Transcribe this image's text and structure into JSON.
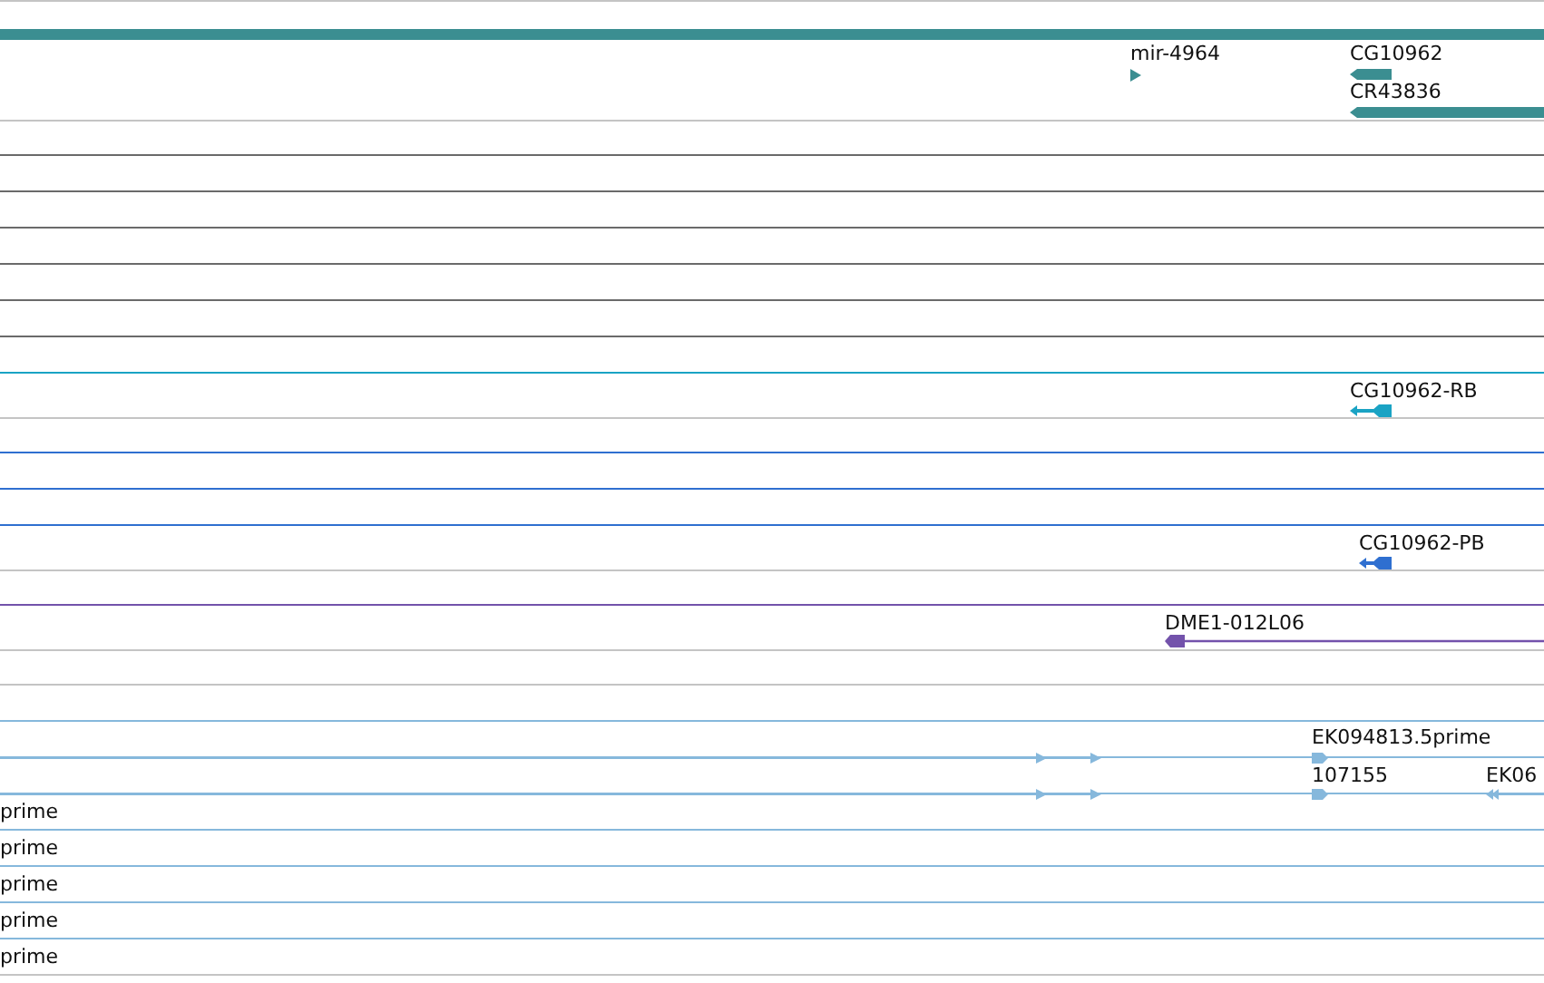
{
  "tracks": [
    {
      "color": "#3b8e91",
      "features": [
        {
          "kind": "band"
        },
        {
          "kind": "marker",
          "label": "mir-4964"
        },
        {
          "kind": "gene",
          "label": "CG10962"
        },
        {
          "kind": "gene",
          "label": "CR43836"
        }
      ]
    },
    {
      "color": "#1aa3c4",
      "features": [
        {
          "kind": "transcript",
          "label": "CG10962-RB"
        }
      ]
    },
    {
      "color": "#2f6fd0",
      "features": [
        {
          "kind": "transcript",
          "label": "CG10962-PB"
        }
      ]
    },
    {
      "color": "#7352ab",
      "features": [
        {
          "kind": "clone",
          "label": "DME1-012L06"
        }
      ]
    },
    {
      "color": "#86b8dc",
      "features": [
        {
          "kind": "pair"
        },
        {
          "kind": "read",
          "label": "EK094813.5prime"
        }
      ]
    },
    {
      "color": "#86b8dc",
      "features": [
        {
          "kind": "pair"
        },
        {
          "kind": "read",
          "label": "107155"
        },
        {
          "kind": "readleft",
          "label": "EK06"
        }
      ]
    },
    {
      "features": [
        {
          "kind": "text",
          "label": "prime"
        }
      ]
    },
    {
      "features": [
        {
          "kind": "text",
          "label": "prime"
        }
      ]
    },
    {
      "features": [
        {
          "kind": "text",
          "label": "prime"
        }
      ]
    },
    {
      "features": [
        {
          "kind": "text",
          "label": "prime"
        }
      ]
    },
    {
      "features": [
        {
          "kind": "text",
          "label": "prime"
        }
      ]
    }
  ]
}
